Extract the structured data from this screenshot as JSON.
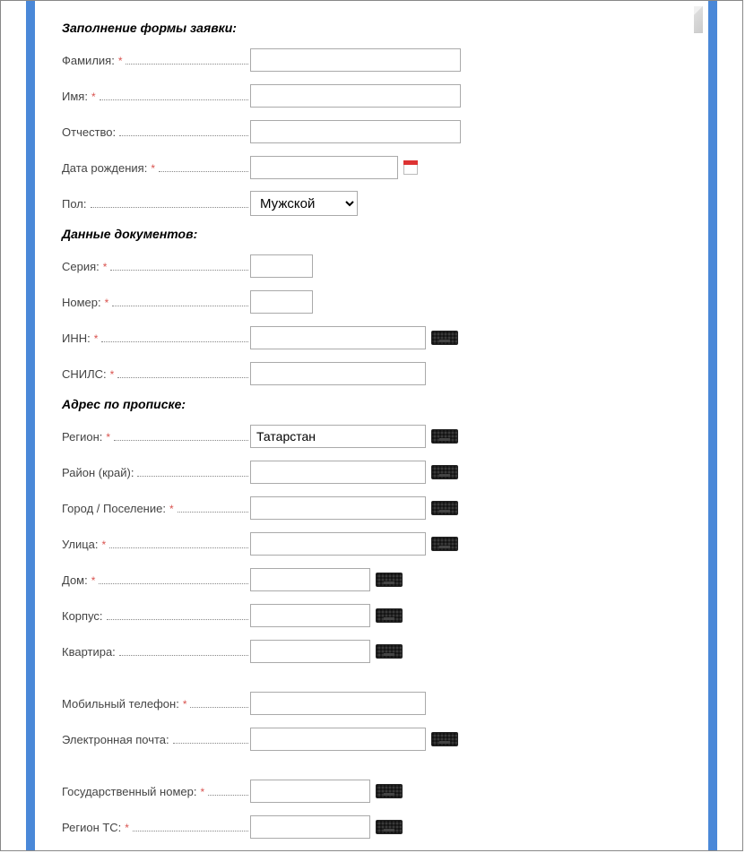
{
  "sections": {
    "s1": "Заполнение формы заявки:",
    "s2": "Данные документов:",
    "s3": "Адрес по прописке:"
  },
  "fields": {
    "lastname": {
      "label": "Фамилия:",
      "required": true,
      "value": ""
    },
    "firstname": {
      "label": "Имя:",
      "required": true,
      "value": ""
    },
    "patronymic": {
      "label": "Отчество:",
      "required": false,
      "value": ""
    },
    "birthdate": {
      "label": "Дата рождения:",
      "required": true,
      "value": ""
    },
    "gender": {
      "label": "Пол:",
      "required": false,
      "value": "Мужской"
    },
    "series": {
      "label": "Серия:",
      "required": true,
      "value": ""
    },
    "number": {
      "label": "Номер:",
      "required": true,
      "value": ""
    },
    "inn": {
      "label": "ИНН:",
      "required": true,
      "value": ""
    },
    "snils": {
      "label": "СНИЛС:",
      "required": true,
      "value": ""
    },
    "region": {
      "label": "Регион:",
      "required": true,
      "value": "Татарстан"
    },
    "district": {
      "label": "Район (край):",
      "required": false,
      "value": ""
    },
    "city": {
      "label": "Город / Поселение:",
      "required": true,
      "value": ""
    },
    "street": {
      "label": "Улица:",
      "required": true,
      "value": ""
    },
    "house": {
      "label": "Дом:",
      "required": true,
      "value": ""
    },
    "building": {
      "label": "Корпус:",
      "required": false,
      "value": ""
    },
    "apartment": {
      "label": "Квартира:",
      "required": false,
      "value": ""
    },
    "mobile": {
      "label": "Мобильный телефон:",
      "required": true,
      "value": ""
    },
    "email": {
      "label": "Электронная почта:",
      "required": false,
      "value": ""
    },
    "gosnomer": {
      "label": "Государственный номер:",
      "required": true,
      "value": ""
    },
    "regionts": {
      "label": "Регион ТС:",
      "required": true,
      "value": ""
    }
  },
  "required_mark": "*"
}
